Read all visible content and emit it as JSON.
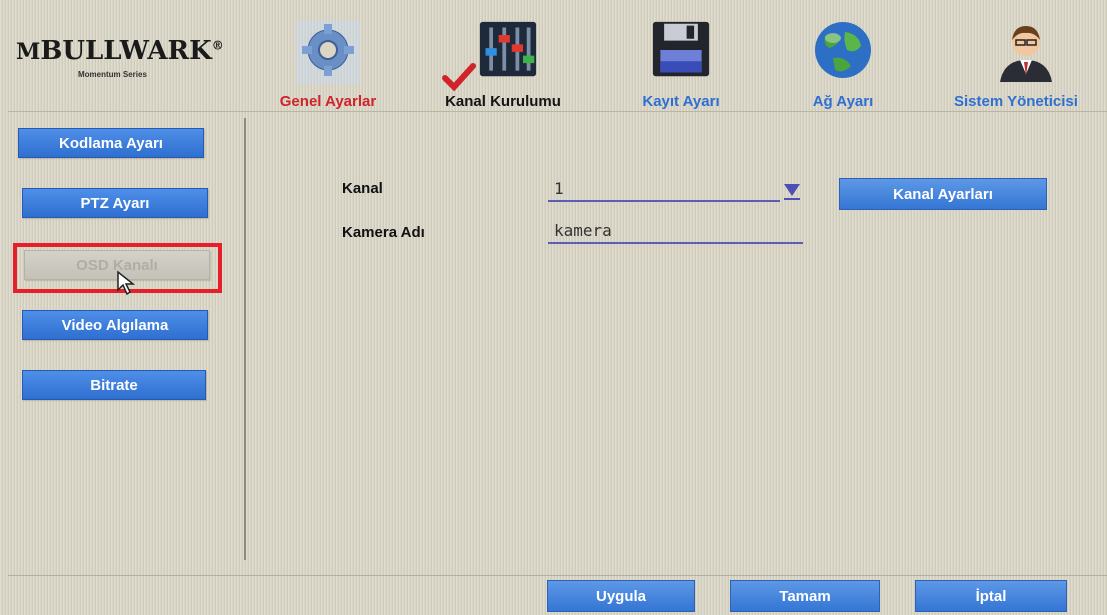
{
  "brand": {
    "name": "BULLWARK",
    "registered": "®",
    "series": "Momentum Series"
  },
  "nav": {
    "tabs": [
      {
        "label": "Genel Ayarlar",
        "icon": "gear-icon",
        "color": "#d0232a"
      },
      {
        "label": "Kanal Kurulumu",
        "icon": "mixer-sliders-icon",
        "color": "#151515",
        "active": true
      },
      {
        "label": "Kayıt Ayarı",
        "icon": "floppy-disk-icon",
        "color": "#2f6fd1"
      },
      {
        "label": "Ağ Ayarı",
        "icon": "globe-icon",
        "color": "#2f6fd1"
      },
      {
        "label": "Sistem Yöneticisi",
        "icon": "user-icon",
        "color": "#2f6fd1"
      }
    ]
  },
  "sidebar": {
    "items": [
      {
        "label": "Kodlama Ayarı"
      },
      {
        "label": "PTZ Ayarı"
      },
      {
        "label": "OSD Kanalı",
        "disabled": true
      },
      {
        "label": "Video Algılama"
      },
      {
        "label": "Bitrate"
      }
    ]
  },
  "form": {
    "channel_label": "Kanal",
    "channel_value": "1",
    "camera_name_label": "Kamera Adı",
    "camera_name_value": "kamera",
    "channel_settings_button": "Kanal Ayarları"
  },
  "footer": {
    "apply": "Uygula",
    "ok": "Tamam",
    "cancel": "İptal"
  },
  "colors": {
    "button_blue": "#3a7cdc",
    "active_tab_red": "#d0232a",
    "highlight_red": "#e4202a",
    "field_underline": "#5a5fb5"
  }
}
